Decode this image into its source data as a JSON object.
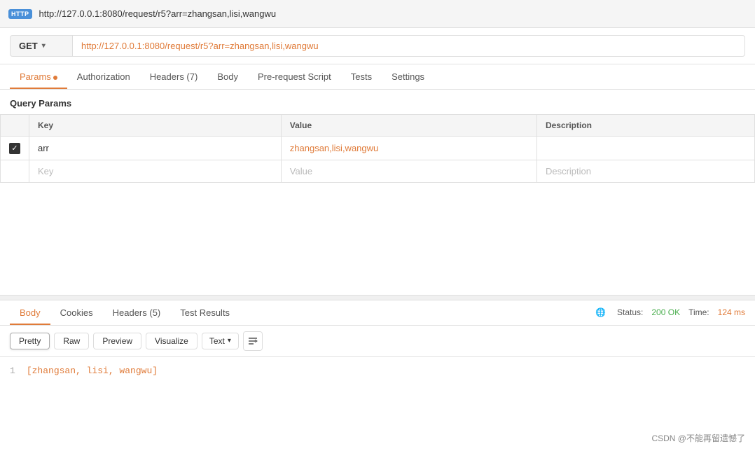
{
  "titleBar": {
    "icon": "HTTP",
    "url": "http://127.0.0.1:8080/request/r5?arr=zhangsan,lisi,wangwu"
  },
  "requestBar": {
    "method": "GET",
    "url": "http://127.0.0.1:8080/request/r5?arr=zhangsan,lisi,wangwu"
  },
  "tabs": [
    {
      "label": "Params",
      "hasDot": true,
      "active": true
    },
    {
      "label": "Authorization",
      "hasDot": false,
      "active": false
    },
    {
      "label": "Headers (7)",
      "hasDot": false,
      "active": false
    },
    {
      "label": "Body",
      "hasDot": false,
      "active": false
    },
    {
      "label": "Pre-request Script",
      "hasDot": false,
      "active": false
    },
    {
      "label": "Tests",
      "hasDot": false,
      "active": false
    },
    {
      "label": "Settings",
      "hasDot": false,
      "active": false
    }
  ],
  "queryParams": {
    "sectionTitle": "Query Params",
    "columns": [
      "Key",
      "Value",
      "Description"
    ],
    "rows": [
      {
        "checked": true,
        "key": "arr",
        "value": "zhangsan,lisi,wangwu",
        "description": ""
      }
    ],
    "emptyRow": {
      "keyPlaceholder": "Key",
      "valuePlaceholder": "Value",
      "descPlaceholder": "Description"
    }
  },
  "responseTabs": [
    {
      "label": "Body",
      "active": true
    },
    {
      "label": "Cookies",
      "active": false
    },
    {
      "label": "Headers (5)",
      "active": false
    },
    {
      "label": "Test Results",
      "active": false
    }
  ],
  "responseStatus": {
    "statusLabel": "Status:",
    "statusValue": "200 OK",
    "timeLabel": "Time:",
    "timeValue": "124 ms"
  },
  "formatBar": {
    "prettyLabel": "Pretty",
    "rawLabel": "Raw",
    "previewLabel": "Preview",
    "visualizeLabel": "Visualize",
    "textLabel": "Text"
  },
  "responseBody": {
    "lineNumber": "1",
    "code": "[zhangsan, lisi, wangwu]"
  },
  "watermark": "CSDN @不能再留遗憾了"
}
